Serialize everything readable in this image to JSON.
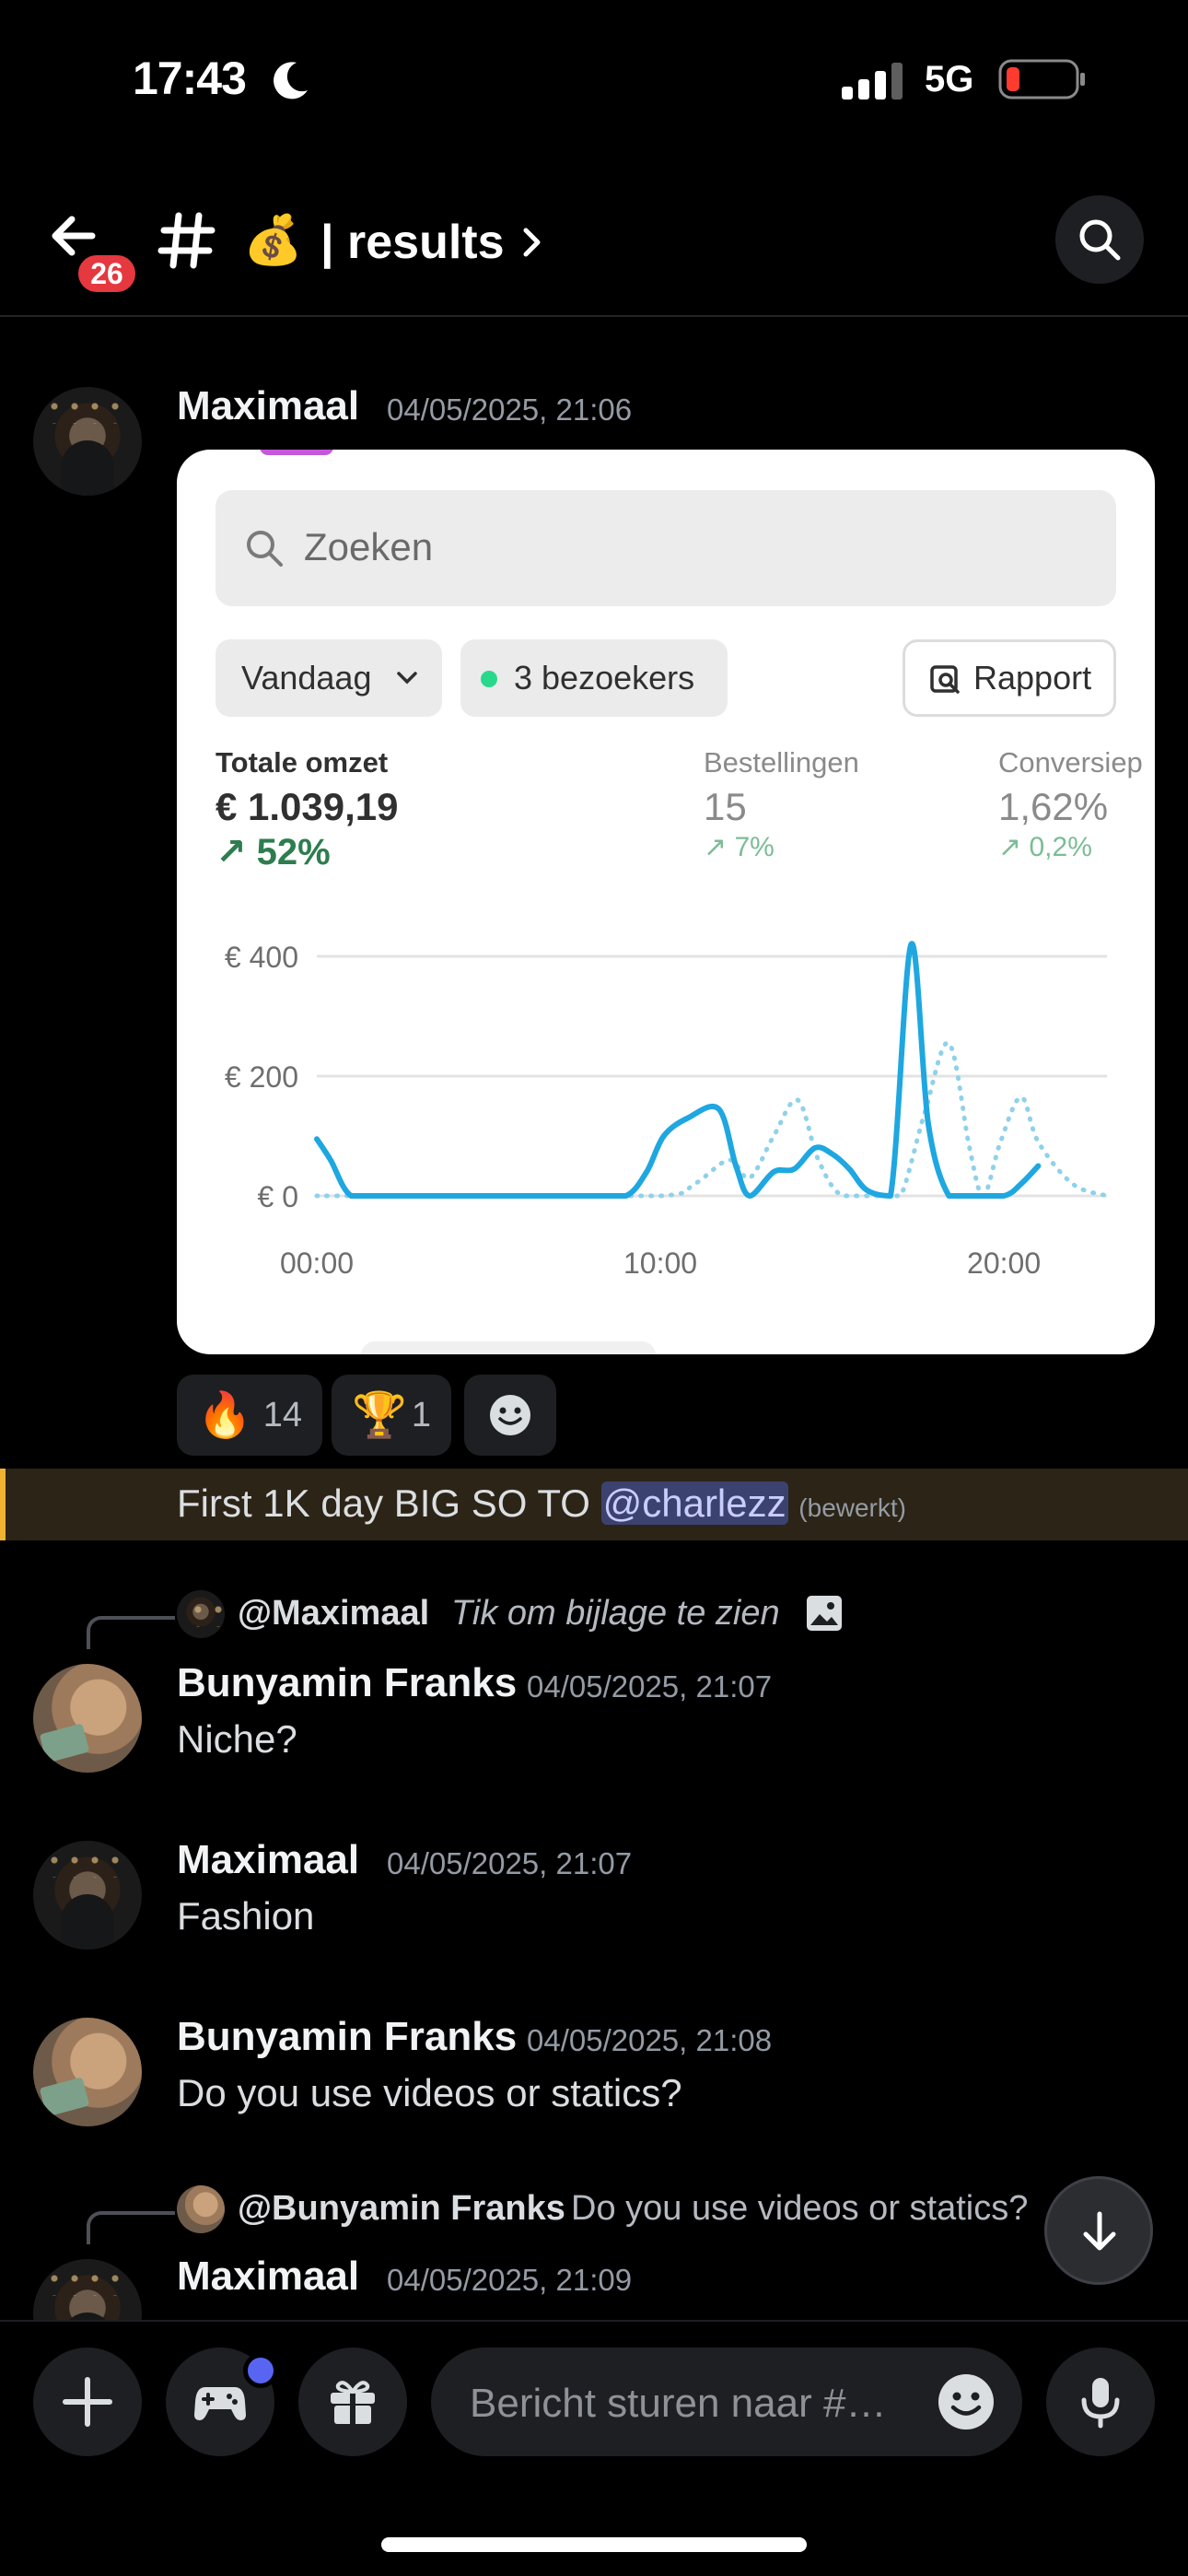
{
  "status_bar": {
    "time": "17:43",
    "network": "5G"
  },
  "header": {
    "unread_count": "26",
    "channel_emoji": "💰",
    "channel_name": "| results"
  },
  "messages": [
    {
      "author": "Maximaal",
      "timestamp": "04/05/2025, 21:06"
    },
    {
      "author": "Bunyamin Franks",
      "timestamp": "04/05/2025, 21:07",
      "text": "Niche?"
    },
    {
      "author": "Maximaal",
      "timestamp": "04/05/2025, 21:07",
      "text": "Fashion"
    },
    {
      "author": "Bunyamin Franks",
      "timestamp": "04/05/2025, 21:08",
      "text": "Do you use videos or statics?"
    },
    {
      "author": "Maximaal",
      "timestamp": "04/05/2025, 21:09"
    }
  ],
  "attachment": {
    "search_placeholder": "Zoeken",
    "date_filter": "Vandaag",
    "visitors": "3 bezoekers",
    "report_button": "Rapport",
    "metrics": [
      {
        "label": "Totale omzet",
        "value": "€ 1.039,19",
        "delta": "52%"
      },
      {
        "label": "Bestellingen",
        "value": "15",
        "delta": "7%"
      },
      {
        "label": "Conversiep",
        "value": "1,62%",
        "delta": "0,2%"
      }
    ]
  },
  "chart_data": {
    "type": "line",
    "y_tick_labels": [
      "€ 400",
      "€ 200",
      "€ 0"
    ],
    "x_tick_labels": [
      "00:00",
      "10:00",
      "20:00"
    ],
    "ylim": [
      0,
      400
    ],
    "grid": true,
    "series": [
      {
        "style": "solid",
        "color": "#1ea7e0",
        "x": [
          0,
          0.4,
          1,
          2,
          5,
          8,
          9,
          9.6,
          10.1,
          10.8,
          11.7,
          12.2,
          12.6,
          13.3,
          13.9,
          14.5,
          15,
          15.5,
          16,
          16.7,
          17.3,
          17.8,
          18.4,
          19,
          20,
          20.5,
          21
        ],
        "y": [
          95,
          60,
          0,
          0,
          0,
          0,
          0,
          40,
          100,
          130,
          145,
          50,
          0,
          40,
          45,
          80,
          70,
          45,
          10,
          0,
          420,
          120,
          0,
          0,
          0,
          20,
          50
        ]
      },
      {
        "style": "dotted",
        "color": "#8fd1ea",
        "x": [
          0,
          0.6,
          5,
          10,
          11,
          12,
          12.6,
          13.3,
          14,
          14.6,
          15.3,
          16.5,
          17,
          17.7,
          18.4,
          19,
          19.4,
          19.9,
          20.5,
          21,
          22,
          23
        ],
        "y": [
          0,
          0,
          0,
          0,
          20,
          60,
          30,
          100,
          160,
          60,
          0,
          0,
          0,
          140,
          255,
          80,
          0,
          90,
          165,
          90,
          20,
          0
        ]
      }
    ]
  },
  "reactions": [
    {
      "emoji": "🔥",
      "count": "14"
    },
    {
      "emoji": "🏆",
      "count": "1"
    }
  ],
  "first_message_text": {
    "before": "First 1K day BIG SO TO ",
    "mention": "@charlezz",
    "edited": "(bewerkt)"
  },
  "replies": [
    {
      "name": "@Maximaal",
      "text": "Tik om bijlage te zien"
    },
    {
      "name": "@Bunyamin Franks",
      "text": "Do you use videos or statics?"
    }
  ],
  "composer": {
    "placeholder": "Bericht sturen naar #…"
  }
}
